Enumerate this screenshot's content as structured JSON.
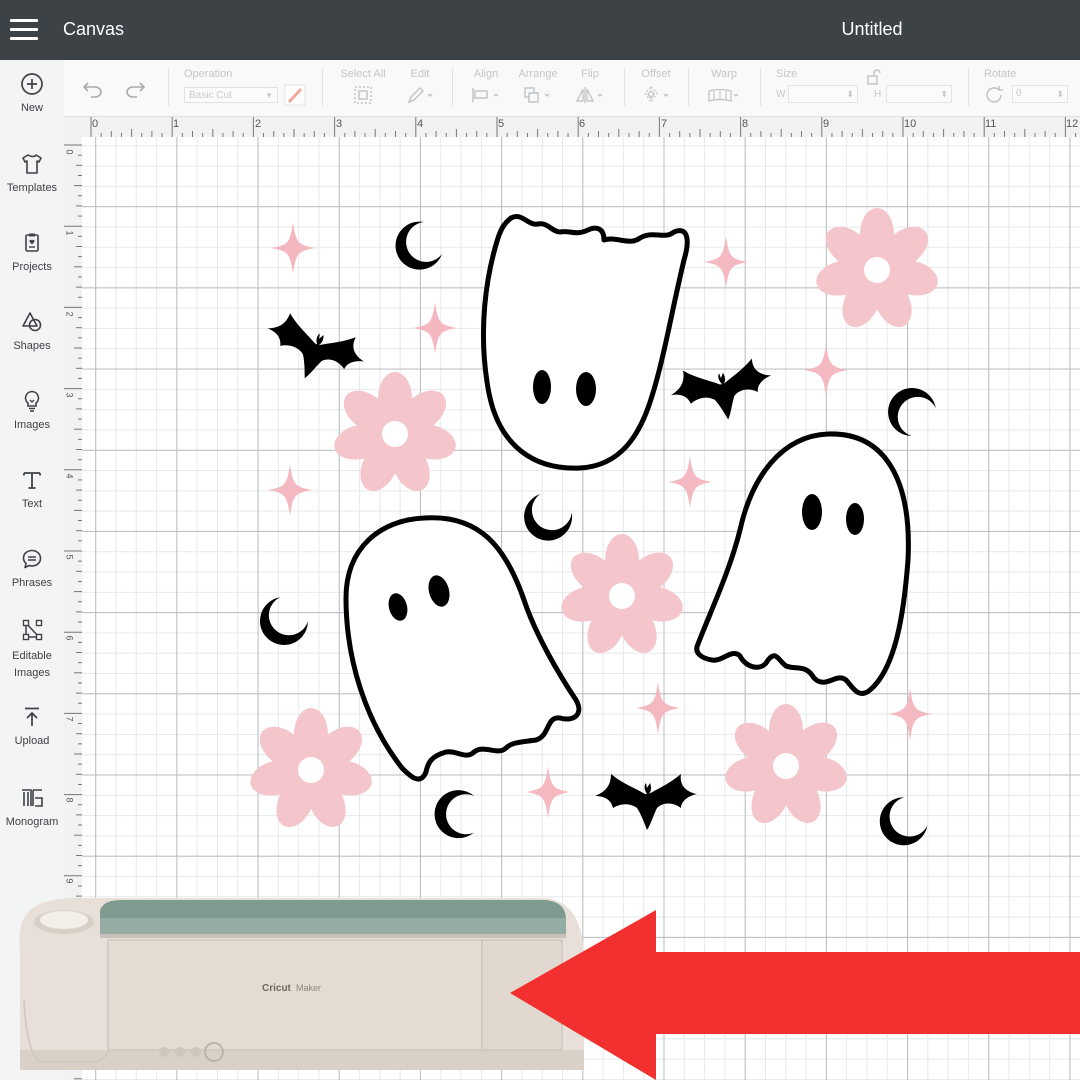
{
  "header": {
    "app_title": "Canvas",
    "doc_title": "Untitled"
  },
  "sidebar": {
    "items": [
      {
        "label": "New",
        "icon": "plus-circle-icon"
      },
      {
        "label": "Templates",
        "icon": "shirt-icon"
      },
      {
        "label": "Projects",
        "icon": "projects-icon"
      },
      {
        "label": "Shapes",
        "icon": "shapes-icon"
      },
      {
        "label": "Images",
        "icon": "lightbulb-icon"
      },
      {
        "label": "Text",
        "icon": "text-icon"
      },
      {
        "label": "Phrases",
        "icon": "speech-bubble-icon"
      },
      {
        "label": "Editable",
        "label2": "Images",
        "icon": "editable-images-icon"
      },
      {
        "label": "Upload",
        "icon": "upload-icon"
      },
      {
        "label": "Monogram",
        "icon": "monogram-icon"
      }
    ]
  },
  "toolbar": {
    "operation_label": "Operation",
    "operation_value": "Basic Cut",
    "select_all_label": "Select All",
    "edit_label": "Edit",
    "align_label": "Align",
    "arrange_label": "Arrange",
    "flip_label": "Flip",
    "offset_label": "Offset",
    "warp_label": "Warp",
    "size_label": "Size",
    "size_w_label": "W",
    "size_h_label": "H",
    "rotate_label": "Rotate",
    "rotate_value": "0"
  },
  "rulers": {
    "horizontal": [
      "0",
      "1",
      "2",
      "3",
      "4",
      "5",
      "6",
      "7",
      "8",
      "9",
      "10",
      "11",
      "12"
    ],
    "vertical": [
      "0",
      "1",
      "2",
      "3",
      "4",
      "5",
      "6",
      "7",
      "8",
      "9"
    ]
  },
  "machine": {
    "brand": "Cricut",
    "model": "Maker"
  },
  "colors": {
    "topbar": "#3d4247",
    "flower_pink": "#f4c6cb",
    "sparkle_pink": "#f4b8c0",
    "arrow_red": "#f2302f",
    "machine_lid": "#7f9a8e"
  }
}
